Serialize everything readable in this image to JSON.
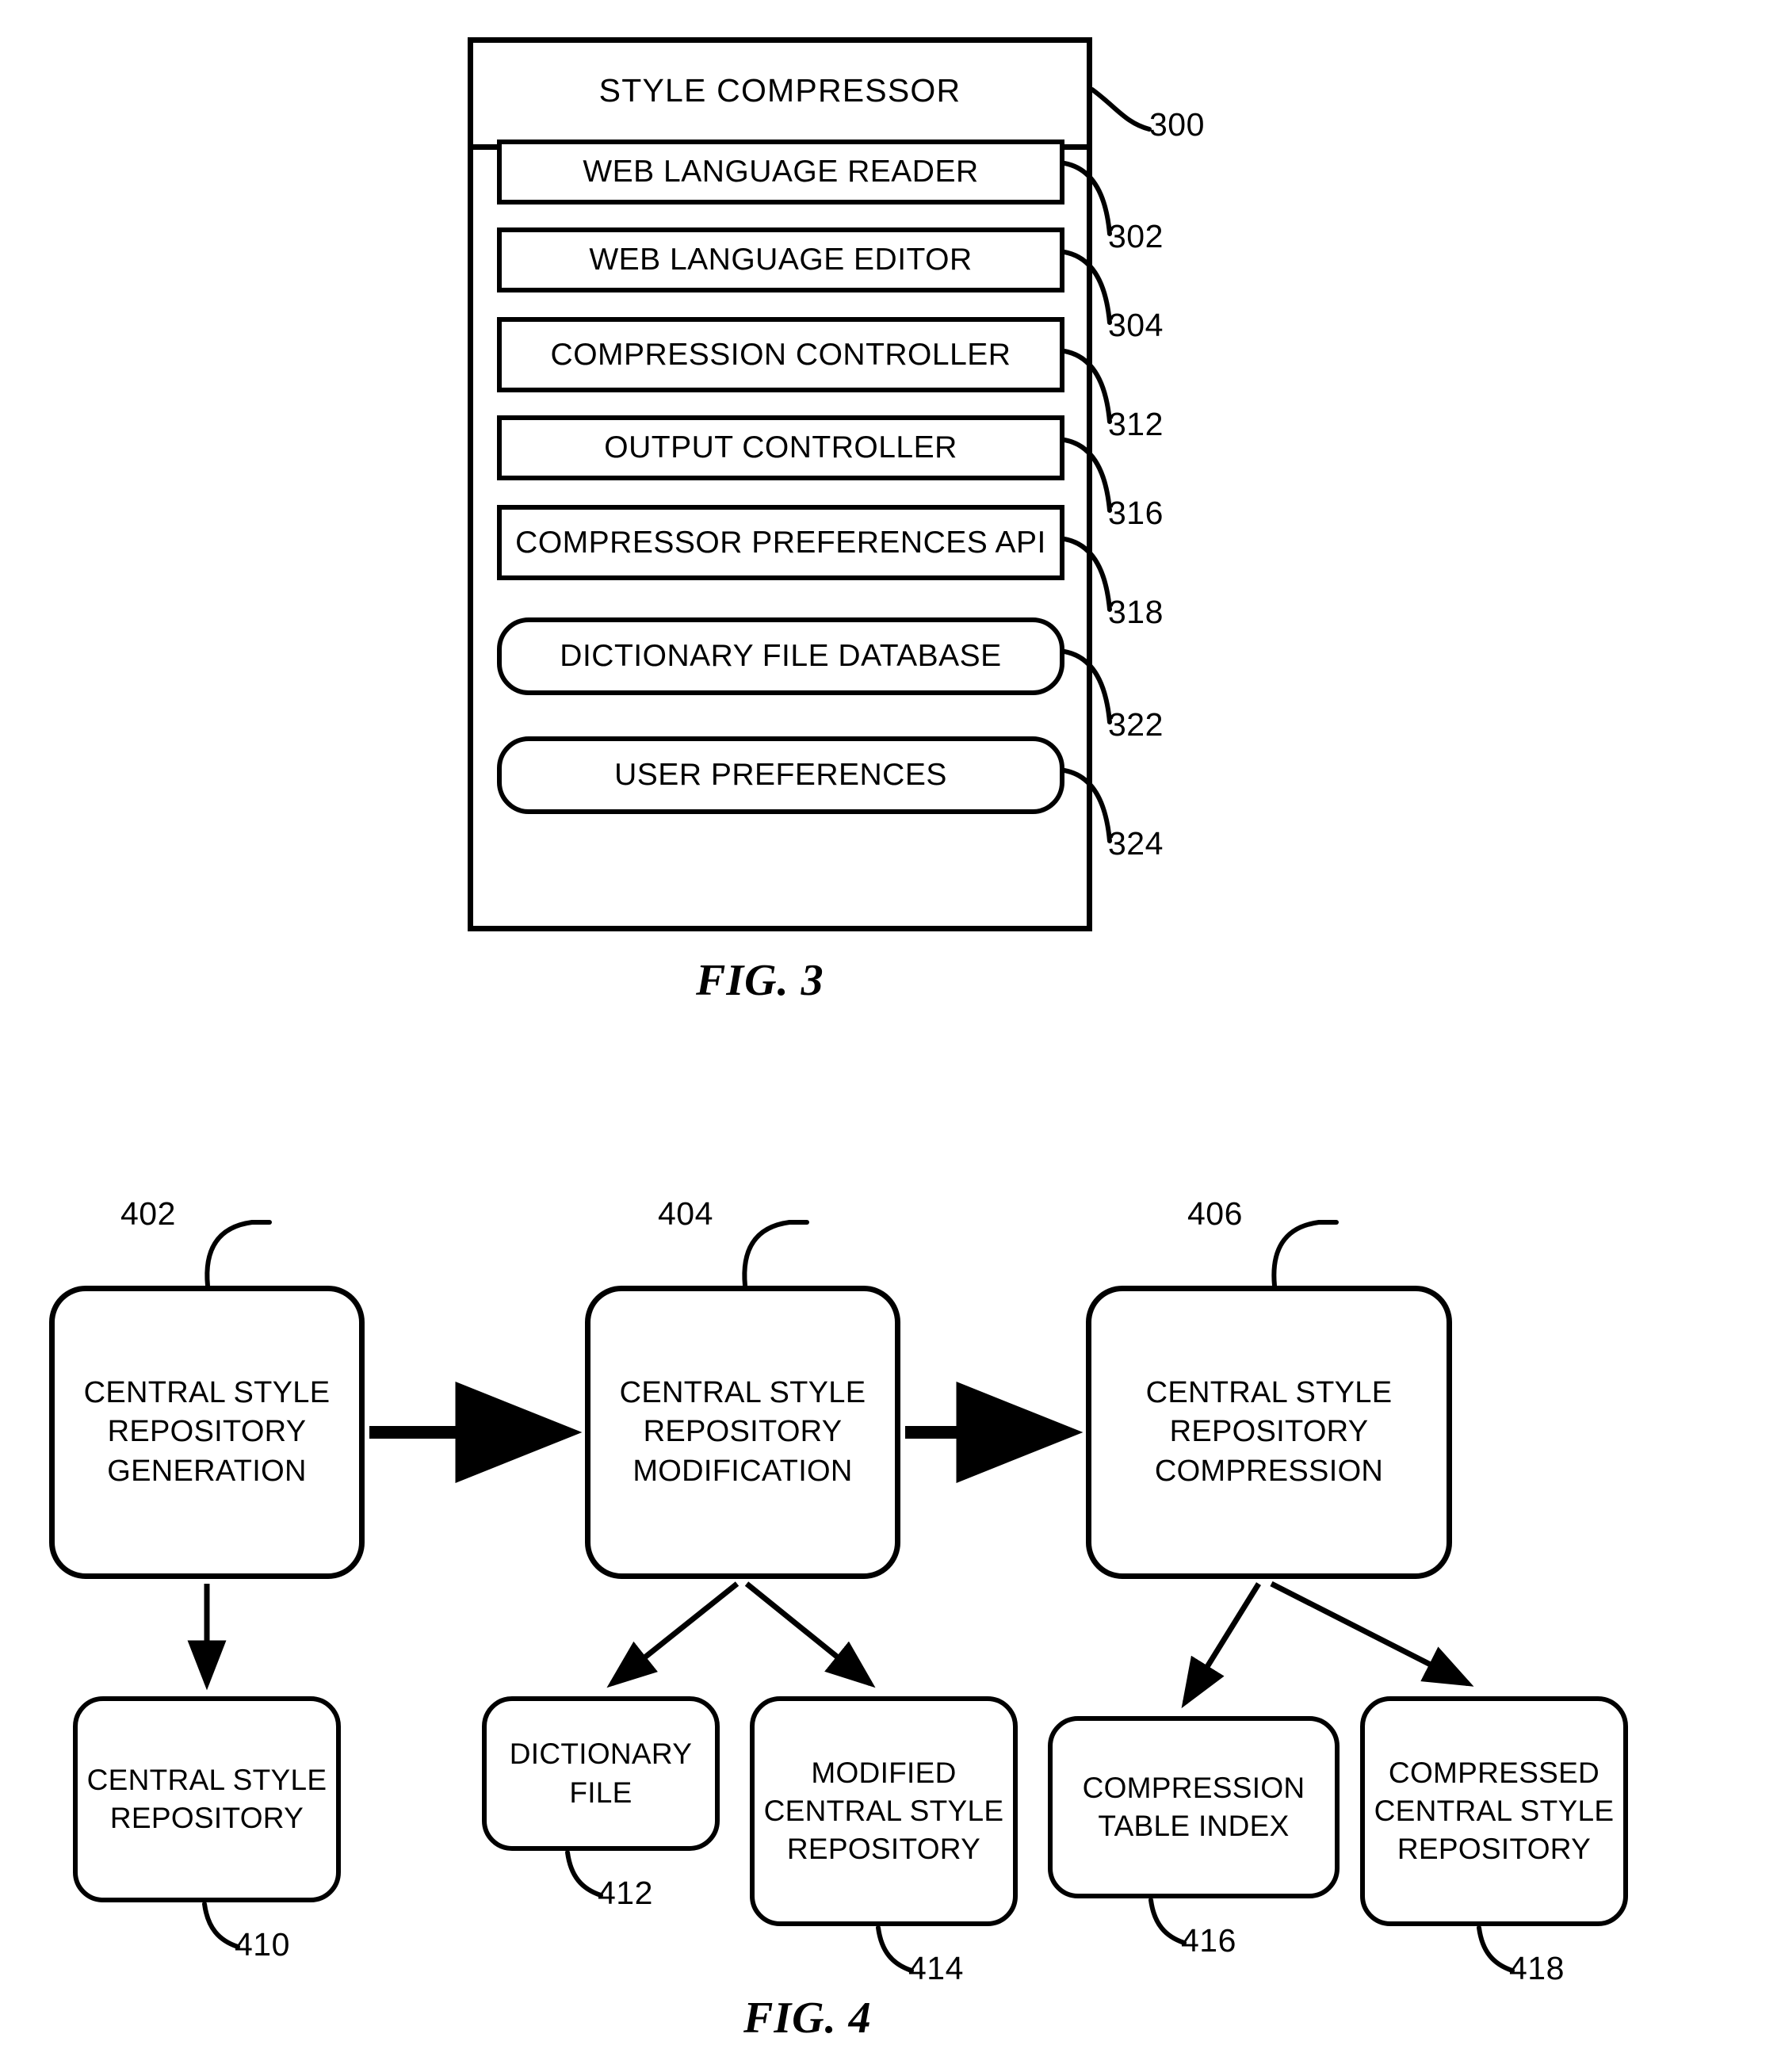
{
  "figures": [
    {
      "caption": "FIG. 3",
      "title": "STYLE COMPRESSOR",
      "title_ref": "300",
      "components": [
        {
          "label": "WEB LANGUAGE READER",
          "ref": "302",
          "shape": "rect"
        },
        {
          "label": "WEB LANGUAGE EDITOR",
          "ref": "304",
          "shape": "rect"
        },
        {
          "label": "COMPRESSION CONTROLLER",
          "ref": "312",
          "shape": "rect"
        },
        {
          "label": "OUTPUT CONTROLLER",
          "ref": "316",
          "shape": "rect"
        },
        {
          "label": "COMPRESSOR PREFERENCES API",
          "ref": "318",
          "shape": "rect"
        },
        {
          "label": "DICTIONARY FILE DATABASE",
          "ref": "322",
          "shape": "round"
        },
        {
          "label": "USER PREFERENCES",
          "ref": "324",
          "shape": "round"
        }
      ]
    },
    {
      "caption": "FIG. 4",
      "stages": [
        {
          "label": "CENTRAL STYLE REPOSITORY GENERATION",
          "ref": "402"
        },
        {
          "label": "CENTRAL STYLE REPOSITORY MODIFICATION",
          "ref": "404"
        },
        {
          "label": "CENTRAL STYLE REPOSITORY COMPRESSION",
          "ref": "406"
        }
      ],
      "outputs": [
        {
          "label": "CENTRAL STYLE REPOSITORY",
          "ref": "410",
          "from": "402"
        },
        {
          "label": "DICTIONARY FILE",
          "ref": "412",
          "from": "404"
        },
        {
          "label": "MODIFIED CENTRAL STYLE REPOSITORY",
          "ref": "414",
          "from": "404"
        },
        {
          "label": "COMPRESSION TABLE INDEX",
          "ref": "416",
          "from": "406"
        },
        {
          "label": "COMPRESSED CENTRAL STYLE REPOSITORY",
          "ref": "418",
          "from": "406"
        }
      ]
    }
  ]
}
